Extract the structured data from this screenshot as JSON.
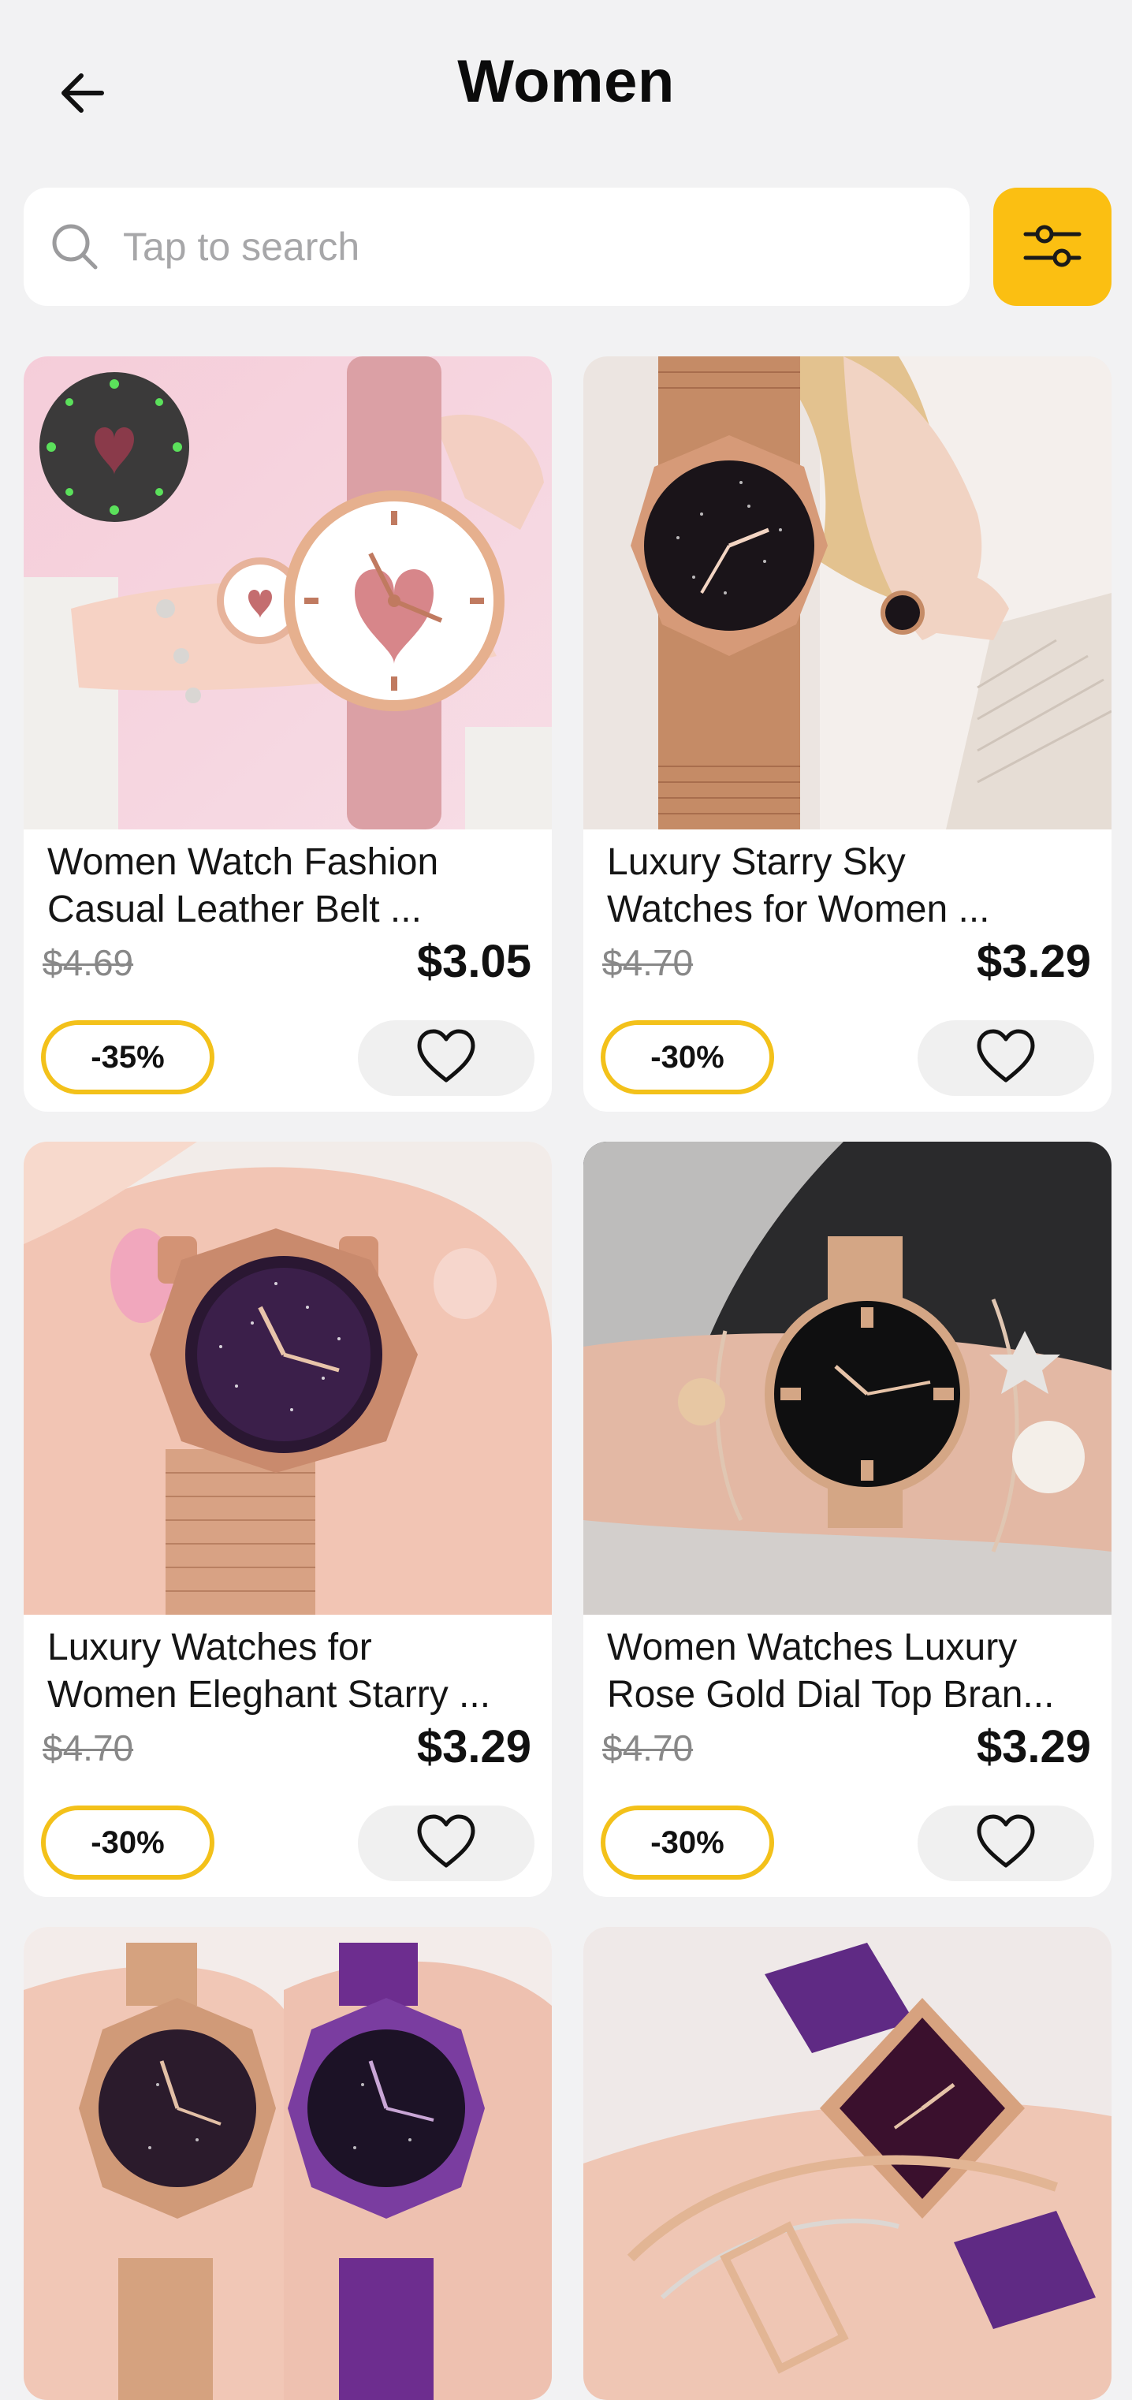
{
  "header": {
    "title": "Women",
    "back_icon": "arrow-left-icon"
  },
  "search": {
    "placeholder": "Tap to search",
    "search_icon": "search-icon",
    "filter_icon": "sliders-icon"
  },
  "colors": {
    "accent": "#FBBF12",
    "background": "#F2F2F3",
    "card": "#FFFFFF"
  },
  "products": [
    {
      "title_line1": "Women Watch Fashion",
      "title_line2": "Casual Leather Belt ...",
      "old_price": "$4.69",
      "price": "$3.05",
      "discount": "-35%"
    },
    {
      "title_line1": "Luxury Starry Sky",
      "title_line2": "Watches for Women ...",
      "old_price": "$4.70",
      "price": "$3.29",
      "discount": "-30%"
    },
    {
      "title_line1": "Luxury Watches for",
      "title_line2": "Women Eleghant Starry ...",
      "old_price": "$4.70",
      "price": "$3.29",
      "discount": "-30%"
    },
    {
      "title_line1": "Women Watches Luxury",
      "title_line2": "Rose Gold Dial Top Bran...",
      "old_price": "$4.70",
      "price": "$3.29",
      "discount": "-30%"
    }
  ]
}
